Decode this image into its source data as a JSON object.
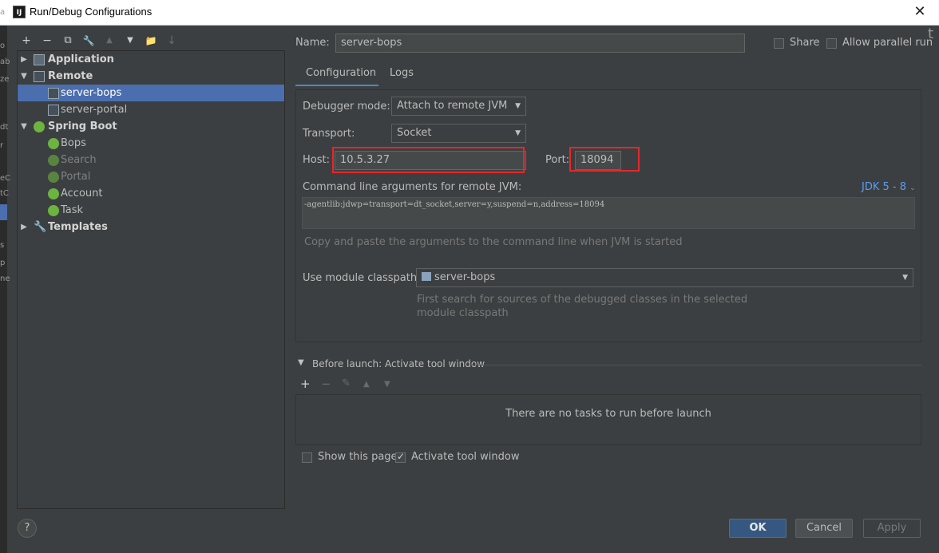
{
  "window": {
    "title": "Run/Debug Configurations",
    "app_icon": "IJ",
    "close_glyph": "✕"
  },
  "ide_strip": [
    "a",
    "o",
    "ab",
    "ze",
    "dt",
    "r",
    "eC",
    "tC",
    "Co",
    "s",
    "p",
    "ne"
  ],
  "toolbar": {
    "add": "+",
    "remove": "−",
    "copy": "⧉",
    "edit_defaults": "🔧",
    "move_up": "▲",
    "move_down": "▼",
    "new_folder": "📁",
    "sort": "↓"
  },
  "tree": {
    "items": [
      {
        "label": "Application",
        "level": 0,
        "expanded": false,
        "icon": "application-icon"
      },
      {
        "label": "Remote",
        "level": 0,
        "expanded": true,
        "icon": "remote-icon"
      },
      {
        "label": "server-bops",
        "level": 1,
        "selected": true,
        "icon": "remote-icon"
      },
      {
        "label": "server-portal",
        "level": 1,
        "icon": "remote-icon"
      },
      {
        "label": "Spring Boot",
        "level": 0,
        "expanded": true,
        "icon": "spring-boot-icon"
      },
      {
        "label": "Bops",
        "level": 1,
        "icon": "spring-boot-icon"
      },
      {
        "label": "Search",
        "level": 1,
        "dim": true,
        "icon": "spring-boot-icon"
      },
      {
        "label": "Portal",
        "level": 1,
        "dim": true,
        "icon": "spring-boot-icon"
      },
      {
        "label": "Account",
        "level": 1,
        "icon": "spring-boot-icon"
      },
      {
        "label": "Task",
        "level": 1,
        "icon": "spring-boot-icon"
      },
      {
        "label": "Templates",
        "level": 0,
        "expanded": false,
        "icon": "wrench-icon"
      }
    ]
  },
  "header": {
    "name_label": "Name:",
    "name_value": "server-bops",
    "share_label": "Share",
    "allow_parallel_label": "Allow parallel run",
    "overflow_glyph": "t"
  },
  "tabs": [
    {
      "label": "Configuration",
      "active": true
    },
    {
      "label": "Logs",
      "active": false
    }
  ],
  "config": {
    "debugger_mode_label": "Debugger mode:",
    "debugger_mode_value": "Attach to remote JVM",
    "transport_label": "Transport:",
    "transport_value": "Socket",
    "host_label": "Host:",
    "host_value": "10.5.3.27",
    "port_label": "Port:",
    "port_value": "18094",
    "cmd_label": "Command line arguments for remote JVM:",
    "jdk_link": "JDK 5 - 8",
    "cmd_value": "-agentlib:jdwp=transport=dt_socket,server=y,suspend=n,address=18094",
    "cmd_hint": "Copy and paste the arguments to the command line when JVM is started",
    "module_label": "Use module classpath:",
    "module_value": "server-bops",
    "module_hint_1": "First search for sources of the debugged classes in the selected",
    "module_hint_2": "module classpath"
  },
  "before_launch": {
    "title": "Before launch: Activate tool window",
    "add": "+",
    "remove": "−",
    "edit": "✎",
    "up": "▲",
    "down": "▼",
    "empty_text": "There are no tasks to run before launch",
    "show_page_label": "Show this page",
    "show_page_checked": false,
    "activate_label": "Activate tool window",
    "activate_checked": true
  },
  "footer": {
    "help": "?",
    "ok": "OK",
    "cancel": "Cancel",
    "apply": "Apply"
  },
  "colors": {
    "selection": "#4b6eaf",
    "highlight_box": "#e5282a",
    "link": "#589df6",
    "primary_button": "#365880"
  }
}
